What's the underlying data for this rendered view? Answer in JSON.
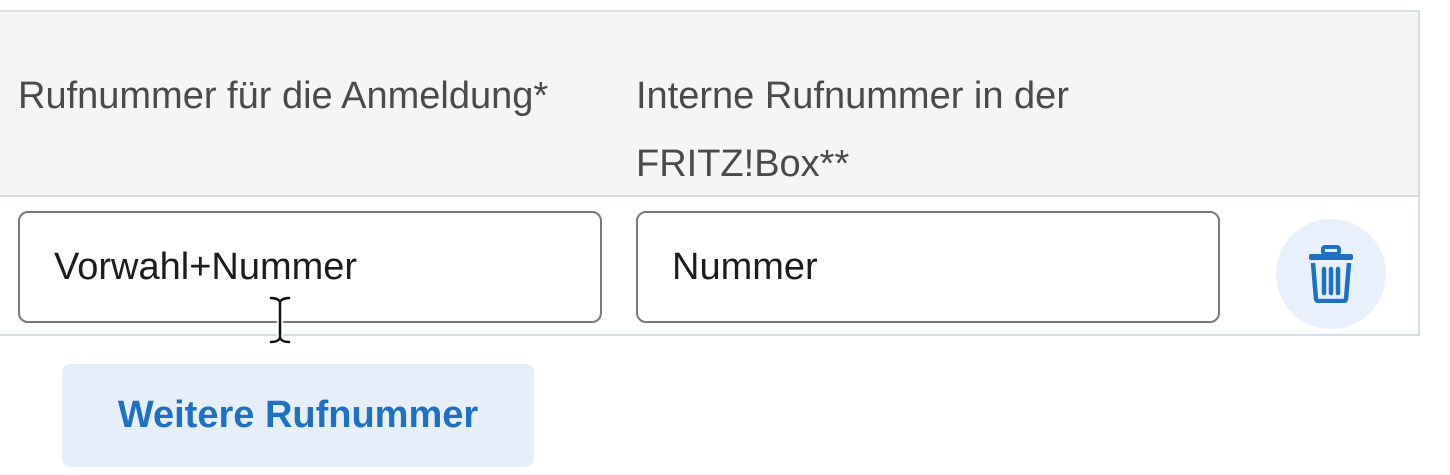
{
  "table": {
    "headers": {
      "col1": "Rufnummer für die Anmeldung*",
      "col2": "Interne Rufnummer in der FRITZ!Box**"
    },
    "row": {
      "col1_value": "Vorwahl+Nummer",
      "col2_value": "Nummer",
      "delete_icon": "trash-icon"
    }
  },
  "add_button": {
    "label": "Weitere Rufnummer"
  },
  "colors": {
    "accent": "#1f6fc4",
    "button_bg": "#e6eff9",
    "header_bg": "#f5f5f3"
  }
}
